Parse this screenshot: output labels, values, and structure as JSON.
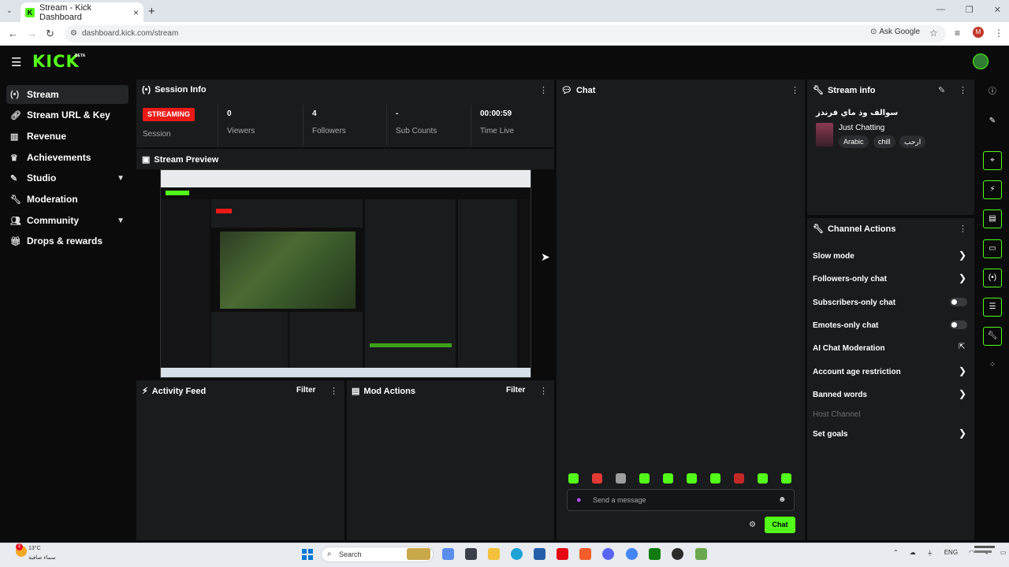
{
  "browser": {
    "tab_title": "Stream - Kick Dashboard",
    "url": "dashboard.kick.com/stream",
    "ask_google": "Ask Google",
    "profile_initial": "M"
  },
  "header": {
    "logo": "KICK",
    "beta": "BETA"
  },
  "sidebar": {
    "items": [
      {
        "label": "Stream",
        "icon": "broadcast-icon",
        "active": true
      },
      {
        "label": "Stream URL & Key",
        "icon": "link-icon"
      },
      {
        "label": "Revenue",
        "icon": "chart-icon"
      },
      {
        "label": "Achievements",
        "icon": "trophy-icon"
      },
      {
        "label": "Studio",
        "icon": "palette-icon",
        "expandable": true
      },
      {
        "label": "Moderation",
        "icon": "wrench-icon"
      },
      {
        "label": "Community",
        "icon": "people-icon",
        "expandable": true
      },
      {
        "label": "Drops & rewards",
        "icon": "gift-icon"
      }
    ]
  },
  "session": {
    "title": "Session Info",
    "status_badge": "STREAMING",
    "session_label": "Session",
    "stats": [
      {
        "value": "0",
        "label": "Viewers"
      },
      {
        "value": "4",
        "label": "Followers"
      },
      {
        "value": "-",
        "label": "Sub Counts"
      },
      {
        "value": "00:00:59",
        "label": "Time Live"
      }
    ]
  },
  "preview": {
    "title": "Stream Preview"
  },
  "activity": {
    "title": "Activity Feed",
    "filter": "Filter"
  },
  "mod": {
    "title": "Mod Actions",
    "filter": "Filter"
  },
  "chat": {
    "title": "Chat",
    "placeholder": "Send a message",
    "button": "Chat",
    "emote_colors": [
      "#53fc18",
      "#e53935",
      "#9e9e9e",
      "#53fc18",
      "#53fc18",
      "#53fc18",
      "#53fc18",
      "#c62828",
      "#53fc18",
      "#53fc18"
    ]
  },
  "stream_info": {
    "title": "Stream info",
    "stream_title": "سوالف وذ ماي فرندز",
    "category": "Just Chatting",
    "tags": [
      "Arabic",
      "chill",
      "ارحب"
    ]
  },
  "channel_actions": {
    "title": "Channel Actions",
    "items": [
      {
        "label": "Slow mode",
        "control": "arrow"
      },
      {
        "label": "Followers-only chat",
        "control": "arrow"
      },
      {
        "label": "Subscribers-only chat",
        "control": "toggle",
        "enabled": false
      },
      {
        "label": "Emotes-only chat",
        "control": "toggle",
        "enabled": false
      },
      {
        "label": "AI Chat Moderation",
        "control": "external"
      },
      {
        "label": "Account age restriction",
        "control": "arrow"
      },
      {
        "label": "Banned words",
        "control": "arrow"
      },
      {
        "label": "Host Channel",
        "control": "none",
        "disabled": true
      },
      {
        "label": "Set goals",
        "control": "arrow"
      }
    ]
  },
  "taskbar": {
    "temperature": "13°C",
    "condition": "سماء صافية",
    "search": "Search",
    "lang": "ENG",
    "notification_count": "2"
  }
}
